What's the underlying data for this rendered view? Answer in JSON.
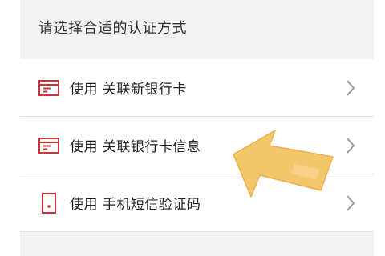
{
  "header": {
    "title": "请选择合适的认证方式"
  },
  "options": [
    {
      "prefix": "使用",
      "text": "关联新银行卡",
      "icon": "bank-card-icon"
    },
    {
      "prefix": "使用",
      "text": "关联银行卡信息",
      "icon": "bank-card-icon"
    },
    {
      "prefix": "使用",
      "text": "手机短信验证码",
      "icon": "phone-icon"
    }
  ],
  "colors": {
    "accent_red": "#c8343a",
    "arrow_yellow": "#f4c465",
    "chevron_gray": "#9a9a9a",
    "background_gray": "#f2f2f2"
  }
}
